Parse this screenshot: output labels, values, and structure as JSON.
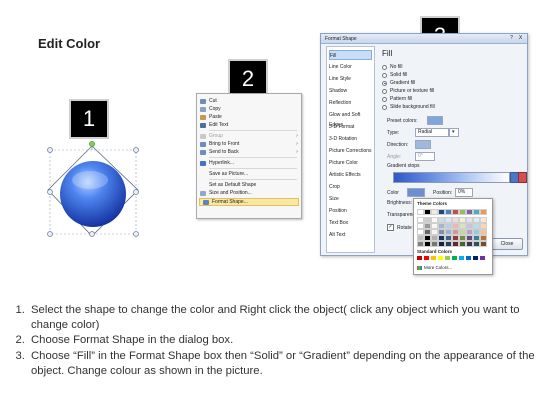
{
  "title": "Edit Color",
  "steps": [
    "1",
    "2",
    "3"
  ],
  "context_menu": {
    "items": [
      {
        "label": "Cut",
        "disabled": false,
        "submenu": false
      },
      {
        "label": "Copy",
        "disabled": false,
        "submenu": false
      },
      {
        "label": "Paste",
        "disabled": false,
        "submenu": false
      },
      {
        "label": "Edit Text",
        "disabled": false,
        "submenu": false
      },
      {
        "label": "Group",
        "disabled": true,
        "submenu": true
      },
      {
        "label": "Bring to Front",
        "disabled": false,
        "submenu": true
      },
      {
        "label": "Send to Back",
        "disabled": false,
        "submenu": true
      },
      {
        "label": "Hyperlink...",
        "disabled": false,
        "submenu": false
      },
      {
        "label": "Save as Picture...",
        "disabled": false,
        "submenu": false
      },
      {
        "label": "Set as Default Shape",
        "disabled": false,
        "submenu": false
      },
      {
        "label": "Size and Position...",
        "disabled": false,
        "submenu": false
      },
      {
        "label": "Format Shape...",
        "disabled": false,
        "submenu": false,
        "highlighted": true
      }
    ]
  },
  "format_dialog": {
    "title": "Format Shape",
    "title_buttons": [
      "?",
      "X"
    ],
    "categories": [
      "Fill",
      "Line Color",
      "Line Style",
      "Shadow",
      "Reflection",
      "Glow and Soft Edges",
      "3-D Format",
      "3-D Rotation",
      "Picture Corrections",
      "Picture Color",
      "Artistic Effects",
      "Crop",
      "Size",
      "Position",
      "Text Box",
      "Alt Text"
    ],
    "selected_category": "Fill",
    "fill_heading": "Fill",
    "fill_options": [
      "No fill",
      "Solid fill",
      "Gradient fill",
      "Picture or texture fill",
      "Pattern fill",
      "Slide background fill"
    ],
    "selected_fill": "Gradient fill",
    "preset_colors_label": "Preset colors:",
    "type_label": "Type:",
    "type_value": "Radial",
    "direction_label": "Direction:",
    "angle_label": "Angle:",
    "angle_value": "0°",
    "gradient_stops_label": "Gradient stops",
    "color_label": "Color",
    "position_label": "Position:",
    "position_value": "0%",
    "brightness_label": "Brightness:",
    "transparency_label": "Transparency:",
    "rotate_label": "Rotate with shape",
    "close_label": "Close"
  },
  "palette": {
    "theme_heading": "Theme Colors",
    "standard_heading": "Standard Colors",
    "more_colors": "More Colors...",
    "theme_top": [
      "#ffffff",
      "#000000",
      "#eeece1",
      "#1f497d",
      "#4f81bd",
      "#c0504d",
      "#9bbb59",
      "#8064a2",
      "#4bacc6",
      "#f79646"
    ],
    "standard": [
      "#c00000",
      "#ff0000",
      "#ffc000",
      "#ffff00",
      "#92d050",
      "#00b050",
      "#00b0f0",
      "#0070c0",
      "#002060",
      "#7030a0"
    ]
  },
  "instructions": [
    "Select the shape to change the color and Right click the object( click any object which you want to change color)",
    "Choose Format Shape in the dialog box.",
    "Choose “Fill” in the Format Shape box then “Solid” or “Gradient” depending on the appearance of the object. Change colour as shown in the picture."
  ],
  "colors": {
    "sphere_dark": "#1a3fb8",
    "sphere_light": "#7fb0ff",
    "menu_highlight": "#fbe7a4"
  }
}
